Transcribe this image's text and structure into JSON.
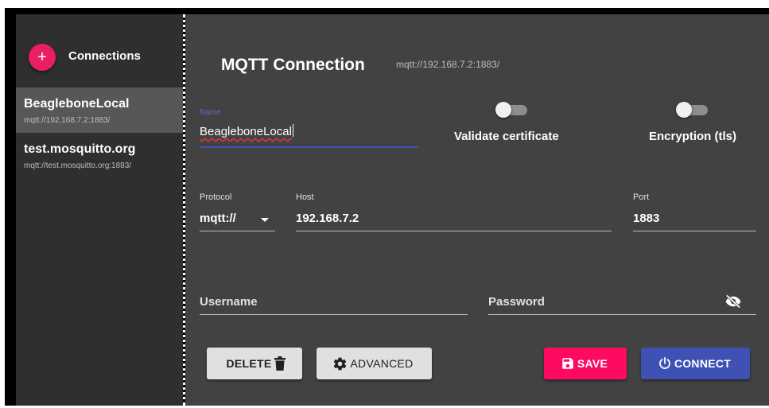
{
  "sidebar": {
    "add_icon": "+",
    "title": "Connections",
    "connections": [
      {
        "name": "BeagleboneLocal",
        "url": "mqtt://192.168.7.2:1883/",
        "active": true
      },
      {
        "name": "test.mosquitto.org",
        "url": "mqtt://test.mosquitto.org:1883/",
        "active": false
      }
    ]
  },
  "main": {
    "title": "MQTT Connection",
    "url": "mqtt://192.168.7.2:1883/",
    "name_field": {
      "label": "Name",
      "value": "BeagleboneLocal"
    },
    "toggles": {
      "validate_certificate": {
        "label": "Validate certificate",
        "checked": false
      },
      "encryption": {
        "label": "Encryption (tls)",
        "checked": false
      }
    },
    "protocol": {
      "label": "Protocol",
      "value": "mqtt://"
    },
    "host": {
      "label": "Host",
      "value": "192.168.7.2"
    },
    "port": {
      "label": "Port",
      "value": "1883"
    },
    "username": {
      "placeholder": "Username"
    },
    "password": {
      "placeholder": "Password"
    },
    "buttons": {
      "delete": "DELETE",
      "advanced": "ADVANCED",
      "save": "SAVE",
      "connect": "CONNECT"
    }
  },
  "colors": {
    "accent_pink": "#e91e63",
    "save_button": "#ff0a61",
    "connect_button": "#3f51b5",
    "active_item": "#575757",
    "panel": "#424242",
    "sidebar": "#2f2f2f"
  },
  "icons": {
    "add": "plus-icon",
    "delete": "trash-icon",
    "advanced": "gear-icon",
    "save": "floppy-disk-icon",
    "connect": "power-icon",
    "password_visibility": "eye-off-icon",
    "protocol_dropdown": "chevron-down-icon"
  }
}
